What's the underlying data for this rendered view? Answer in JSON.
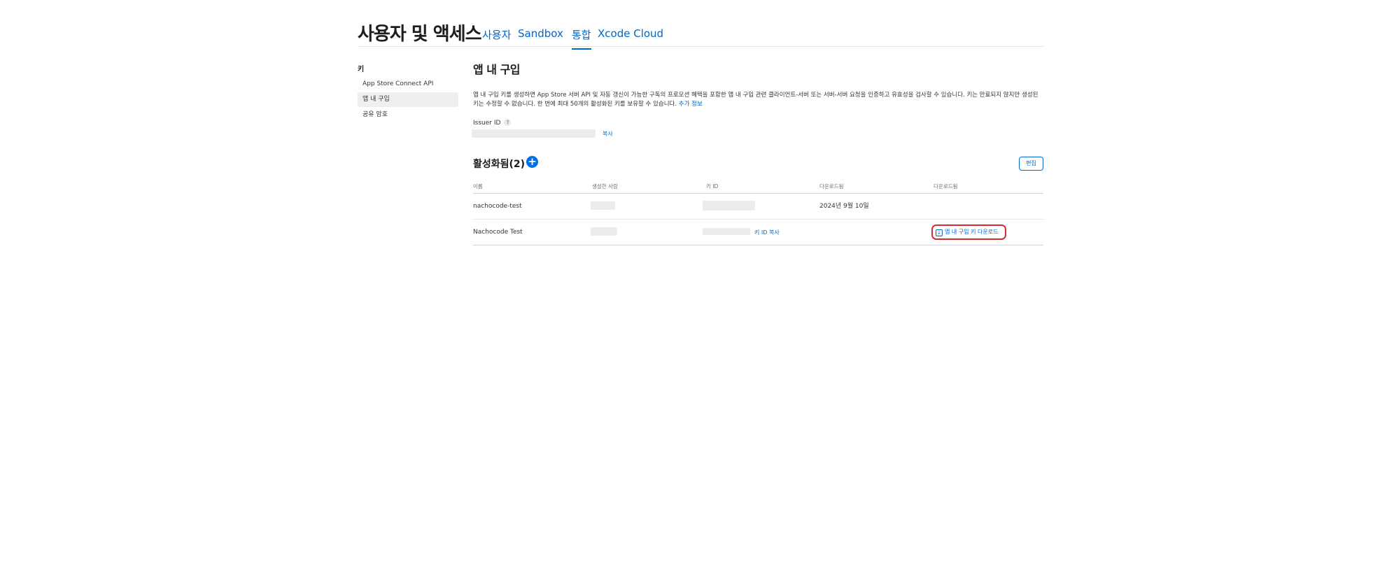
{
  "header": {
    "title": "사용자 및 액세스",
    "tabs": [
      {
        "label": "사용자"
      },
      {
        "label": "Sandbox"
      },
      {
        "label": "통합"
      },
      {
        "label": "Xcode Cloud"
      }
    ],
    "active_tab": "통합"
  },
  "sidebar": {
    "heading": "키",
    "items": [
      {
        "label": "App Store Connect API"
      },
      {
        "label": "앱 내 구입"
      },
      {
        "label": "공유 암호"
      }
    ],
    "active_item": "앱 내 구입"
  },
  "main": {
    "title": "앱 내 구입",
    "description": "앱 내 구입 키를 생성하면 App Store 서버 API 및 자동 갱신이 가능한 구독의 프로모션 혜택을 포함한 앱 내 구입 관련 클라이언트-서버 또는 서버-서버 요청을 인증하고 유효성을 검사할 수 있습니다. 키는 만료되지 않지만 생성된 키는 수정할 수 없습니다. 한 번에 최대 50개의 활성화된 키를 보유할 수 있습니다.",
    "more_info_link": "추가 정보",
    "issuer_label": "Issuer ID",
    "help_icon": "?",
    "copy_label": "복사",
    "active_heading": "활성화됨(2)",
    "add_button": "+",
    "edit_button": "편집",
    "table": {
      "headers": [
        "이름",
        "생성한 사람",
        "키 ID",
        "다운로드됨",
        "다운로드됨"
      ],
      "rows": [
        {
          "name": "nachocode-test",
          "downloaded": "2024년 9월 10일"
        },
        {
          "name": "Nachocode Test",
          "copy_key_id": "키 ID 복사",
          "download_button": "앱 내 구입 키 다운로드"
        }
      ]
    }
  },
  "colors": {
    "link": "#0066cc",
    "accent": "#0071e3",
    "highlight_outline": "#d92b2b"
  }
}
